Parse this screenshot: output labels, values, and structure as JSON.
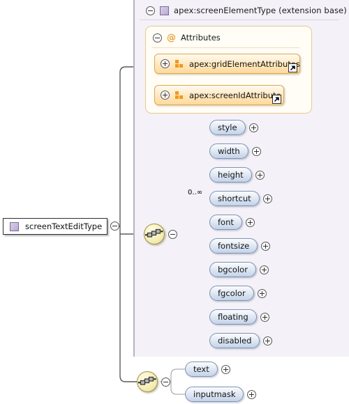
{
  "diagram": {
    "kind": "xml-schema-diagram",
    "root_element": {
      "label": "screenTextEditType",
      "icon": "type-square-icon",
      "toggle": "minus-circle-icon"
    },
    "extension_base": {
      "title": "apex:screenElementType (extension base)",
      "icon": "type-square-icon",
      "toggle": "minus-circle-icon"
    },
    "attributes_box": {
      "label": "Attributes",
      "icon": "at-sign-icon",
      "toggle": "minus-circle-icon",
      "groups": [
        {
          "label": "apex:gridElementAttributes",
          "toggle": "plus-circle-icon",
          "icon": "attribute-group-icon",
          "badge": "external-link-icon"
        },
        {
          "label": "apex:screenIdAttribute",
          "toggle": "plus-circle-icon",
          "icon": "attribute-group-icon",
          "badge": "external-link-icon"
        }
      ]
    },
    "sequence_primary": {
      "icon": "sequence-icon",
      "toggle": "minus-circle-icon",
      "elements": [
        {
          "label": "style",
          "toggle": "plus-circle-icon",
          "occurrence": ""
        },
        {
          "label": "width",
          "toggle": "plus-circle-icon",
          "occurrence": ""
        },
        {
          "label": "height",
          "toggle": "plus-circle-icon",
          "occurrence": ""
        },
        {
          "label": "shortcut",
          "toggle": "plus-circle-icon",
          "occurrence": "0..∞"
        },
        {
          "label": "font",
          "toggle": "plus-circle-icon",
          "occurrence": ""
        },
        {
          "label": "fontsize",
          "toggle": "plus-circle-icon",
          "occurrence": ""
        },
        {
          "label": "bgcolor",
          "toggle": "plus-circle-icon",
          "occurrence": ""
        },
        {
          "label": "fgcolor",
          "toggle": "plus-circle-icon",
          "occurrence": ""
        },
        {
          "label": "floating",
          "toggle": "plus-circle-icon",
          "occurrence": ""
        },
        {
          "label": "disabled",
          "toggle": "plus-circle-icon",
          "occurrence": ""
        }
      ]
    },
    "sequence_secondary": {
      "icon": "sequence-icon",
      "toggle": "minus-circle-icon",
      "elements": [
        {
          "label": "text",
          "toggle": "plus-circle-icon",
          "occurrence": ""
        },
        {
          "label": "inputmask",
          "toggle": "plus-circle-icon",
          "occurrence": ""
        }
      ]
    },
    "colors": {
      "panel_background": "#f4f1f8",
      "panel_border": "#b9b3c2",
      "attribute_box_background": "#fffdf6",
      "attribute_box_border": "#e8c98d",
      "attribute_group_fill": "#ffd99b",
      "attribute_group_border": "#dda94f",
      "attribute_icon": "#ef9a1e",
      "element_pill_fill": "#c3d3ea",
      "element_pill_border": "#7f93b2",
      "sequence_circle_fill": "#f6efb9",
      "sequence_circle_border": "#9a8f4a",
      "type_square_fill": "#b9a9d4",
      "connector_trunk": "#5a5a5a",
      "connector_branch": "#9a9aa5",
      "page_background": "#ffffff"
    }
  }
}
